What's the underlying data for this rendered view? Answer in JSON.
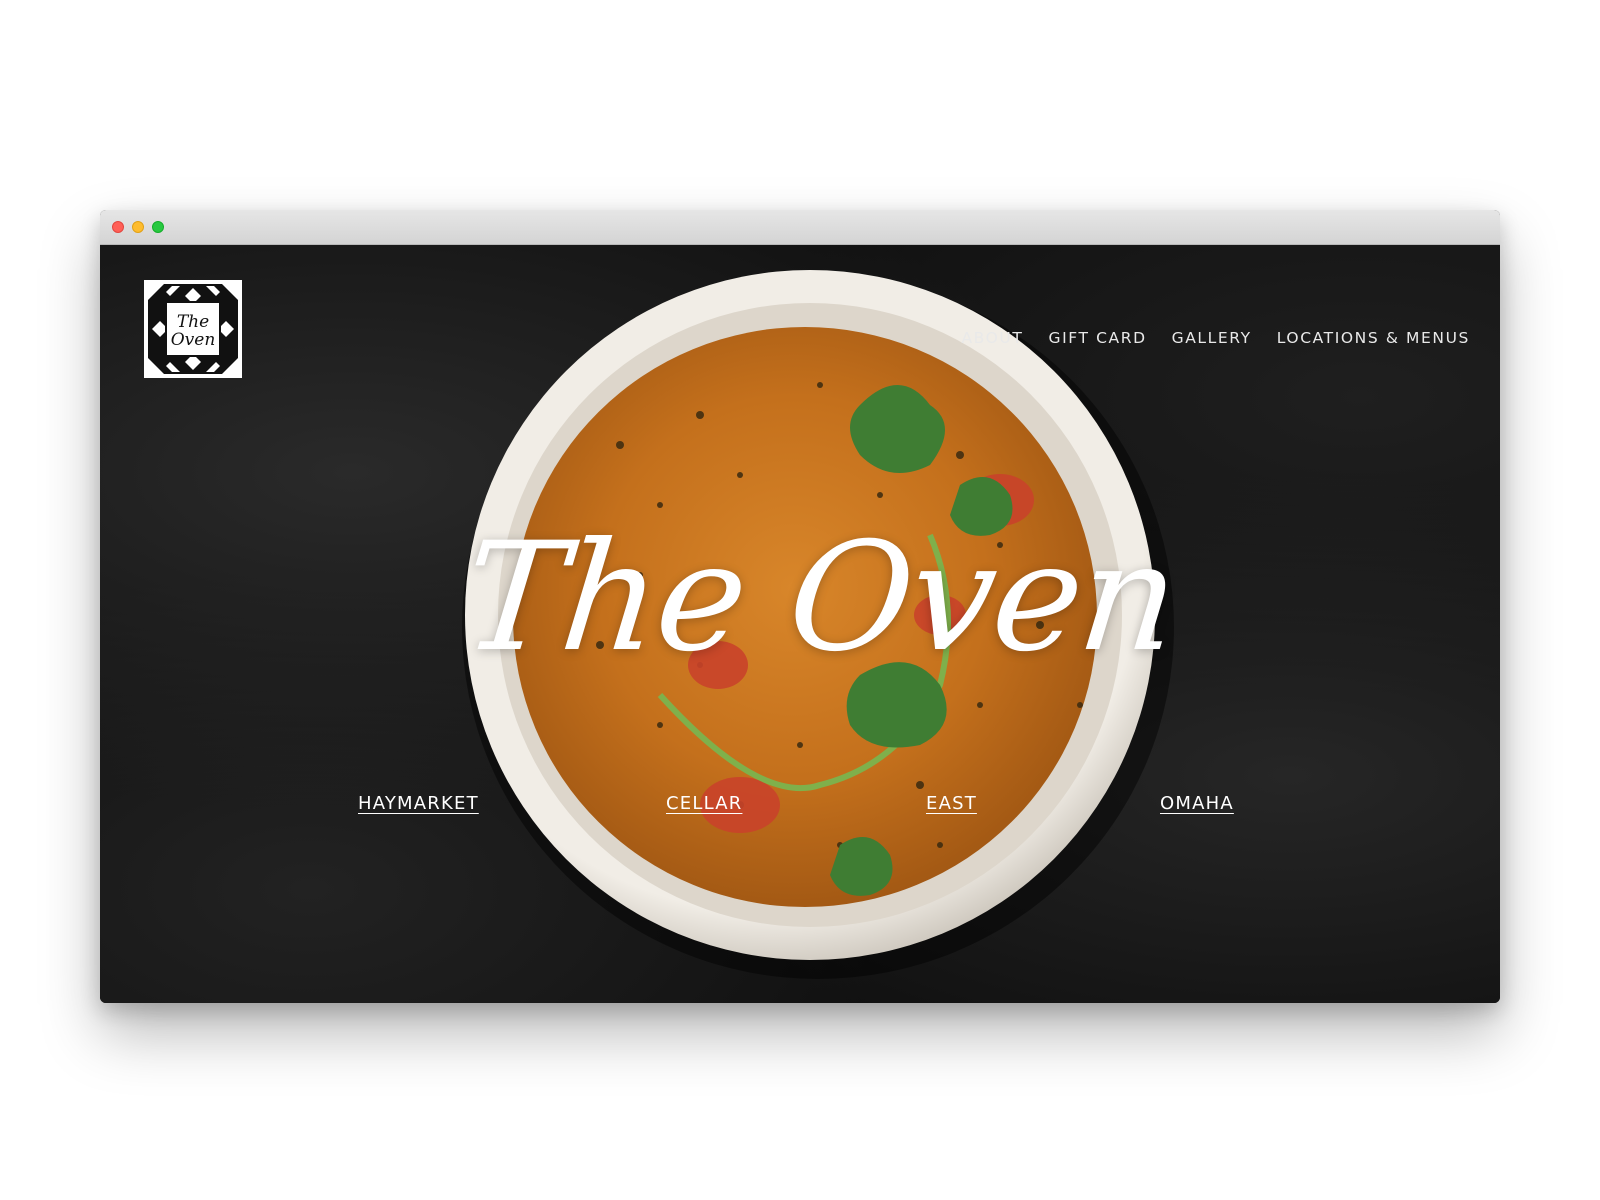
{
  "brand": {
    "logo_text": "The Oven",
    "hero_title": "The Oven"
  },
  "nav": {
    "items": [
      {
        "label": "ABOUT"
      },
      {
        "label": "GIFT CARD"
      },
      {
        "label": "GALLERY"
      },
      {
        "label": "LOCATIONS & MENUS"
      }
    ]
  },
  "locations": [
    {
      "label": "HAYMARKET"
    },
    {
      "label": "CELLAR"
    },
    {
      "label": "EAST"
    },
    {
      "label": "OMAHA"
    }
  ],
  "colors": {
    "background": "#111111",
    "bowl": "#e9e4dc",
    "curry": "#c8741c",
    "cilantro": "#3f7d33",
    "text": "#ffffff"
  }
}
